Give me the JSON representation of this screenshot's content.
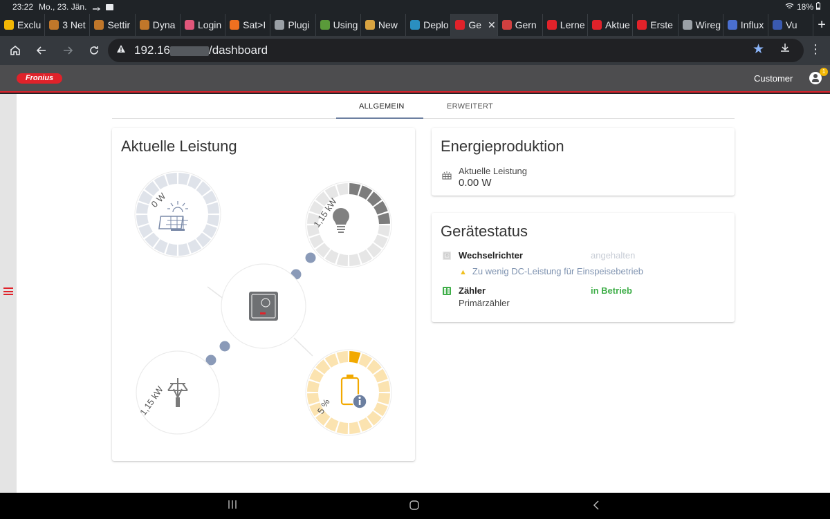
{
  "statusbar": {
    "time": "23:22",
    "date": "Mo., 23. Jän.",
    "battery": "18%"
  },
  "tabs": [
    {
      "label": "Exclu",
      "favicon_color": "#f2b705"
    },
    {
      "label": "3 Net",
      "favicon_color": "#c0772a"
    },
    {
      "label": "Settir",
      "favicon_color": "#c0772a"
    },
    {
      "label": "Dyna",
      "favicon_color": "#c0772a"
    },
    {
      "label": "Login",
      "favicon_color": "#e0567a"
    },
    {
      "label": "Sat>I",
      "favicon_color": "#f07020"
    },
    {
      "label": "Plugi",
      "favicon_color": "#9aa0a6"
    },
    {
      "label": "Using",
      "favicon_color": "#5a9a3a"
    },
    {
      "label": "New ",
      "favicon_color": "#d9a441"
    },
    {
      "label": "Deplo",
      "favicon_color": "#2a8fc0"
    },
    {
      "label": "Ge",
      "favicon_color": "#e0222a",
      "active": true
    },
    {
      "label": "Gern",
      "favicon_color": "#d04040"
    },
    {
      "label": "Lerne",
      "favicon_color": "#e0222a"
    },
    {
      "label": "Aktue",
      "favicon_color": "#e0222a"
    },
    {
      "label": "Erste",
      "favicon_color": "#e0222a"
    },
    {
      "label": "Wireg",
      "favicon_color": "#9aa0a6"
    },
    {
      "label": "Influx",
      "favicon_color": "#4a6fd0"
    },
    {
      "label": "Vu",
      "favicon_color": "#3a5ab0"
    }
  ],
  "address": {
    "url_prefix": "192.16",
    "url_suffix": "/dashboard"
  },
  "header": {
    "user_label": "Customer",
    "badge_count": "1",
    "logo_text": "Fronius"
  },
  "page_tabs": {
    "general": "ALLGEMEIN",
    "extended": "ERWEITERT"
  },
  "leistung": {
    "title": "Aktuelle Leistung",
    "pv_value": "0 W",
    "load_value": "1,15 kW",
    "grid_value": "1,15 kW",
    "battery_value": "5 %",
    "pv_level": 0,
    "load_level": 0.25,
    "battery_level": 0.05
  },
  "energie": {
    "title": "Energieproduktion",
    "label": "Aktuelle Leistung",
    "value": "0.00 W"
  },
  "geraetestatus": {
    "title": "Gerätestatus",
    "inverter_name": "Wechselrichter",
    "inverter_status": "angehalten",
    "warning": "Zu wenig DC-Leistung für Einspeisebetrieb",
    "meter_name": "Zähler",
    "meter_status": "in Betrieb",
    "meter_sub": "Primärzähler",
    "status_colors": {
      "stopped": "#c8cdd6",
      "running": "#3fae49"
    }
  }
}
